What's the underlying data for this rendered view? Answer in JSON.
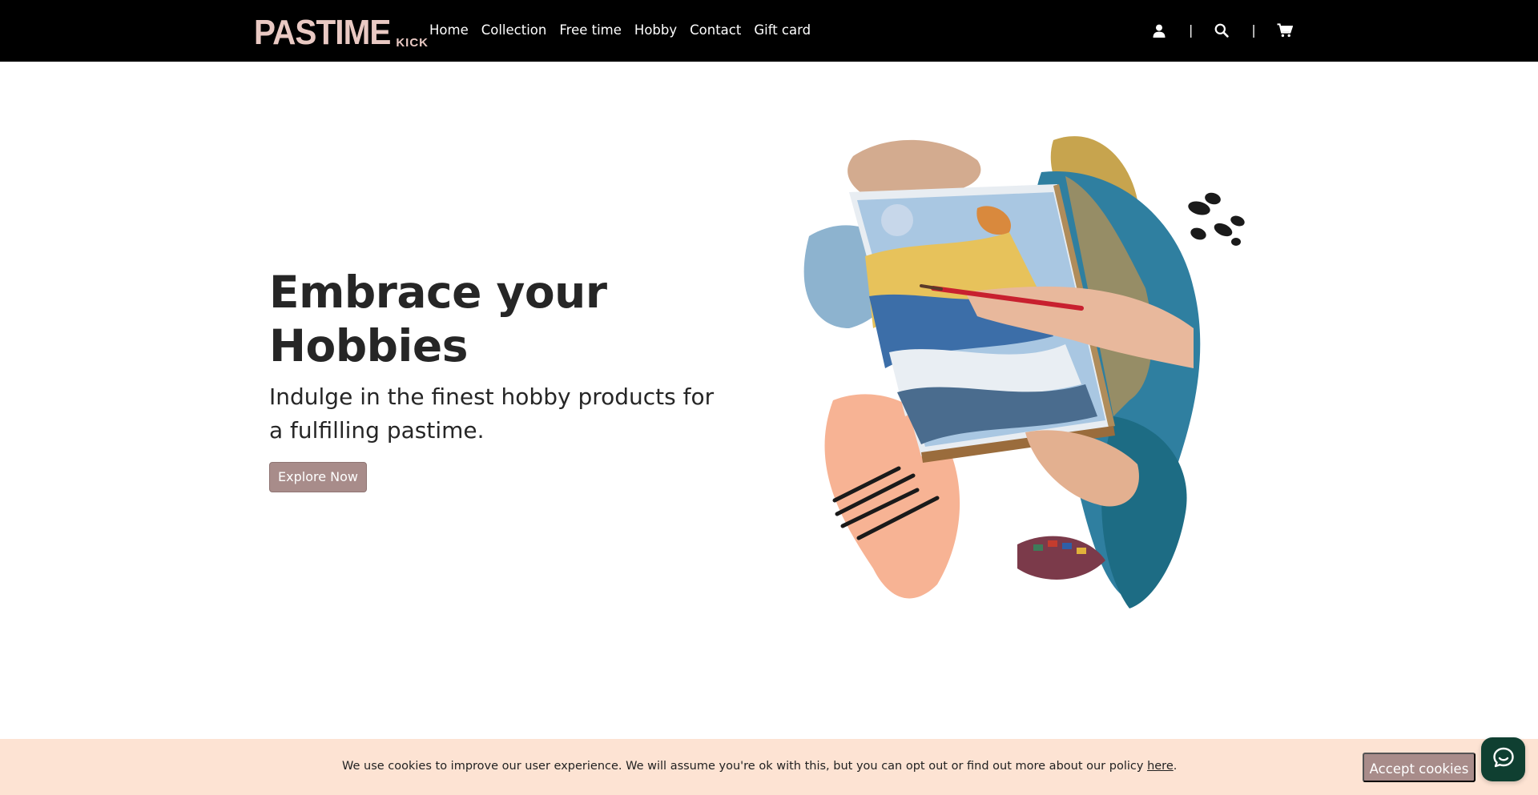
{
  "header": {
    "logo": {
      "main": "PASTIME",
      "sub": "KICK"
    },
    "nav": [
      {
        "label": "Home"
      },
      {
        "label": "Collection"
      },
      {
        "label": "Free time"
      },
      {
        "label": "Hobby"
      },
      {
        "label": "Contact"
      },
      {
        "label": "Gift card"
      }
    ],
    "separator": "|",
    "icons": [
      "user-icon",
      "search-icon",
      "cart-icon"
    ]
  },
  "hero": {
    "title": "Embrace your Hobbies",
    "subtitle": "Indulge in the finest hobby products for a fulfilling pastime.",
    "cta_label": "Explore Now",
    "image_subject": "hand painting a landscape on an easel canvas with paint brush strokes background"
  },
  "cookie": {
    "text": "We use cookies to improve our user experience. We will assume you're ok with this, but you can opt out or find out more about our policy ",
    "link_label": "here",
    "after_link": ".",
    "accept_label": "Accept cookies"
  },
  "chat_widget": {
    "icon": "chat-bubble-icon"
  },
  "colors": {
    "header_bg": "#000000",
    "logo": "#e9c9c3",
    "button": "#a88c8a",
    "cookie_bg": "#fde3d3",
    "chat_bg": "#0f3f31"
  }
}
